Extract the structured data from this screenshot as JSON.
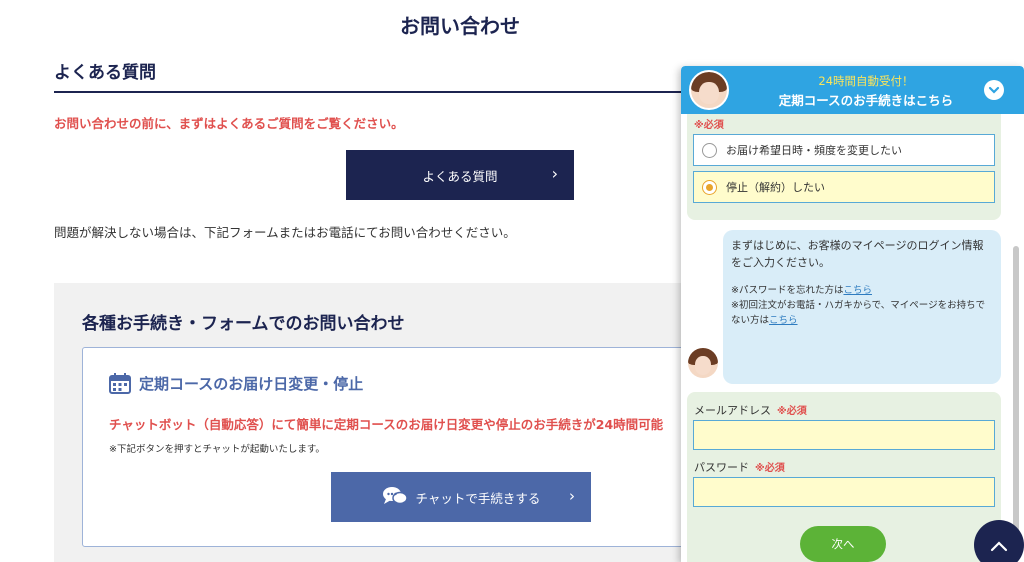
{
  "page": {
    "title": "お問い合わせ"
  },
  "faq": {
    "heading": "よくある質問",
    "note": "お問い合わせの前に、まずはよくあるご質問をご覧ください。",
    "button_label": "よくある質問",
    "after_text": "問題が解決しない場合は、下記フォームまたはお電話にてお問い合わせください。"
  },
  "forms": {
    "heading": "各種お手続き・フォームでのお問い合わせ",
    "card_title": "定期コースのお届け日変更・停止",
    "card_lead": "チャットボット（自動応答）にて簡単に定期コースのお届け日変更や停止のお手続きが24時間可能",
    "card_note": "※下記ボタンを押すとチャットが起動いたします。",
    "chat_button_label": "チャットで手続きする"
  },
  "chat": {
    "header_sub": "24時間自動受付！",
    "header_title": "定期コースのお手続きはこちら",
    "required_tag": "※必須",
    "options": [
      {
        "label": "お届け希望日時・頻度を変更したい",
        "selected": false
      },
      {
        "label": "停止（解約）したい",
        "selected": true
      }
    ],
    "bubble_main": "まずはじめに、お客様のマイページのログイン情報をご入力ください。",
    "bubble_line1_prefix": "※パスワードを忘れた方は",
    "bubble_link": "こちら",
    "bubble_line2_prefix": "※初回注文がお電話・ハガキからで、マイページをお持ちでない方は",
    "email_label": "メールアドレス",
    "password_label": "パスワード",
    "required": "※必須",
    "next_label": "次へ"
  },
  "colors": {
    "navy": "#1c2450",
    "accent_red": "#e0504e",
    "chat_blue": "#2fa4e2",
    "button_blue": "#4c68a8",
    "green": "#5cb337"
  }
}
